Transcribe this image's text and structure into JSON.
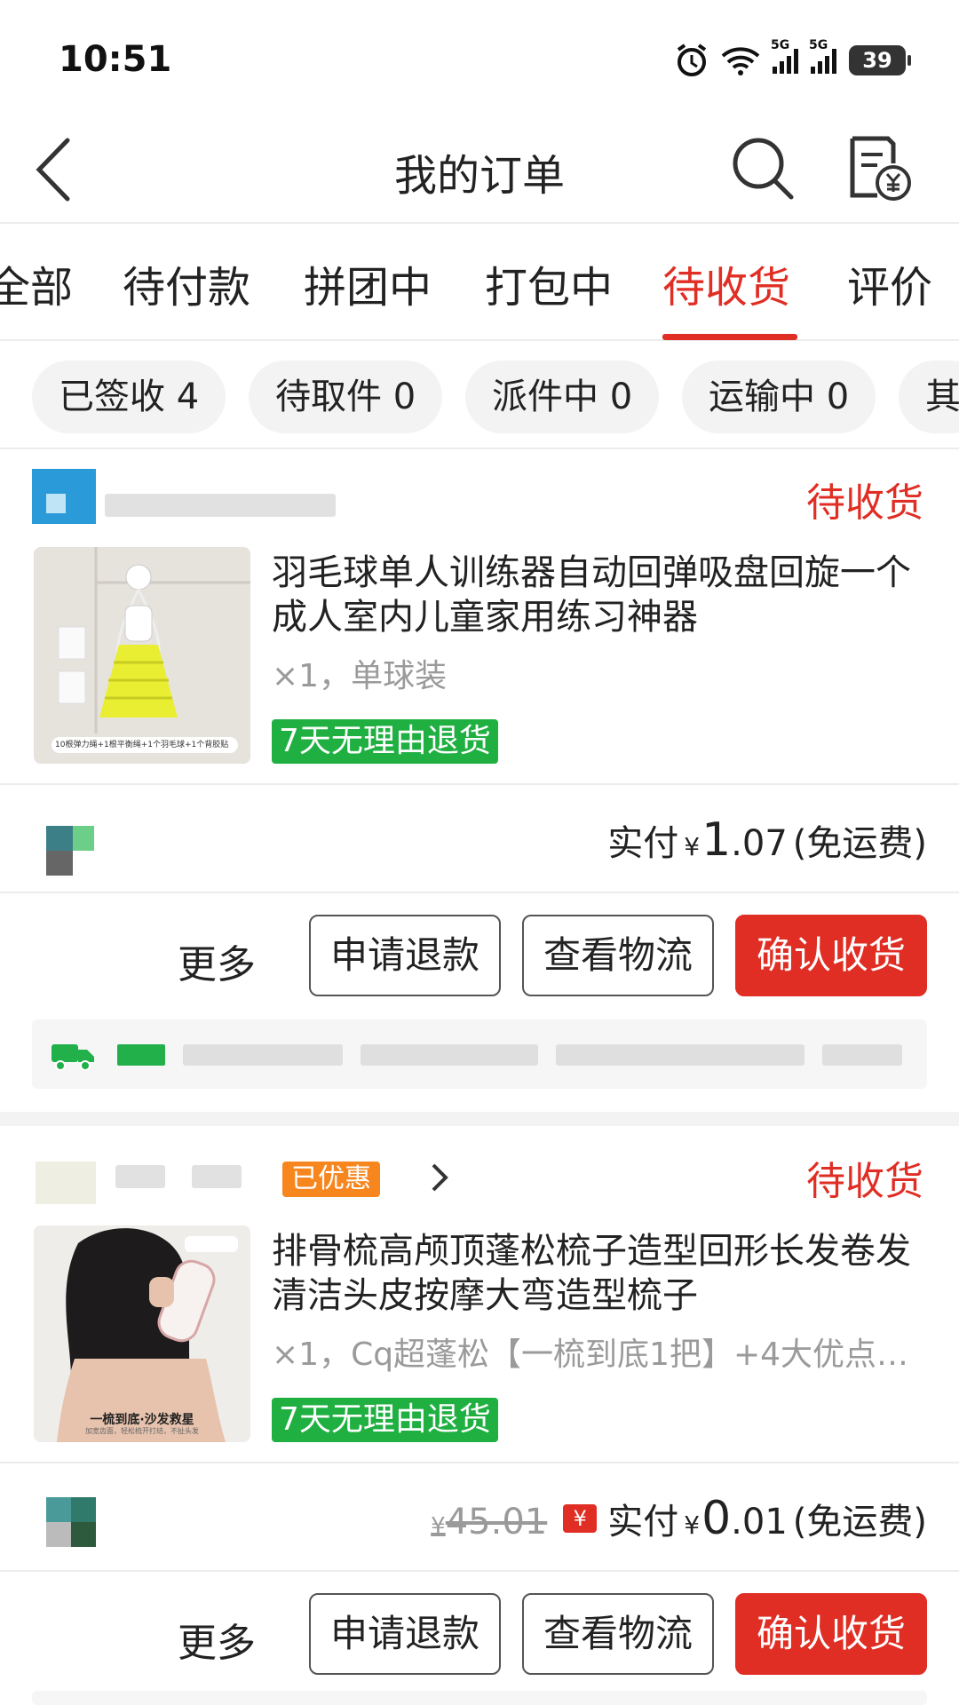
{
  "status_bar": {
    "time": "10:51",
    "battery": "39",
    "net1": "5G",
    "net2": "5G"
  },
  "header": {
    "title": "我的订单"
  },
  "tabs": [
    {
      "label": "全部"
    },
    {
      "label": "待付款"
    },
    {
      "label": "拼团中"
    },
    {
      "label": "打包中"
    },
    {
      "label": "待收货",
      "active": true
    },
    {
      "label": "评价"
    }
  ],
  "chips": [
    "已签收 4",
    "待取件 0",
    "派件中 0",
    "运输中 0",
    "其"
  ],
  "colors": {
    "accent": "#e02e24",
    "badge": "#20b042"
  },
  "orders": [
    {
      "status": "待收货",
      "title": "羽毛球单人训练器自动回弹吸盘回旋一个成人室内儿童家用练习神器",
      "spec": "×1，单球装",
      "badge": "7天无理由退货",
      "thumb_caption": "10根弹力绳+1根平衡绳+1个羽毛球+1个背胶贴",
      "pay_label": "实付",
      "currency": "¥",
      "pay_int": "1",
      "pay_dec": ".07",
      "shipping": "(免运费)",
      "more": "更多",
      "refund": "申请退款",
      "logistics": "查看物流",
      "confirm": "确认收货"
    },
    {
      "status": "待收货",
      "promo": "已优惠",
      "title": "排骨梳高颅顶蓬松梳子造型回形长发卷发清洁头皮按摩大弯造型梳子",
      "spec": "×1，Cq超蓬松【一梳到底1把】+4大优点…",
      "badge": "7天无理由退货",
      "thumb_caption": "一梳到底·沙发救星",
      "thumb_subcaption": "加宽齿面，轻松梳开打结，不扯头发",
      "orig_currency": "¥",
      "orig_price": "45.01",
      "hongbao": "¥",
      "pay_label": "实付",
      "currency": "¥",
      "pay_int": "0",
      "pay_dec": ".01",
      "shipping": "(免运费)",
      "more": "更多",
      "refund": "申请退款",
      "logistics": "查看物流",
      "confirm": "确认收货"
    }
  ]
}
